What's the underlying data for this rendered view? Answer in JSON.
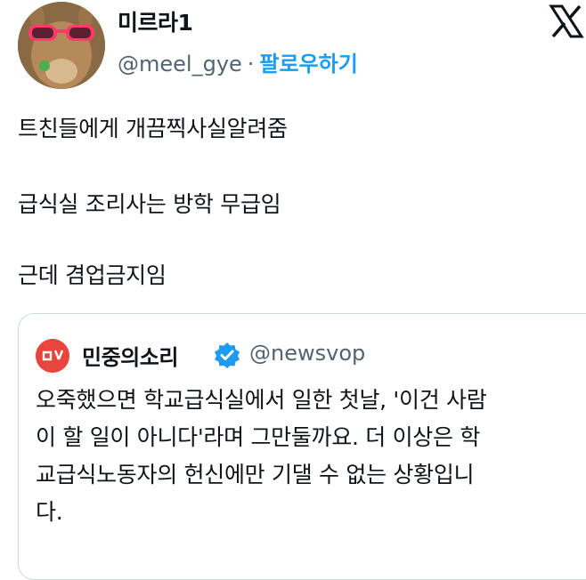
{
  "author": {
    "display_name": "미르라1",
    "handle": "@meel_gye",
    "separator": "·",
    "follow_label": "팔로우하기"
  },
  "tweet": {
    "lines": [
      "트친들에게 개끔찍사실알려줌",
      "급식실 조리사는 방학 무급임",
      "근데 겸업금지임"
    ]
  },
  "quote": {
    "display_name": "민중의소리",
    "handle": "@newsvop",
    "lines": [
      "오죽했으면 학교급식실에서 일한 첫날, '이건 사람",
      "이 할 일이 아니다'라며 그만둘까요. 더 이상은 학",
      "교급식노동자의 헌신에만 기댈 수 없는 상황입니",
      "다."
    ]
  },
  "icons": {
    "logo": "x-logo-icon",
    "verified": "verified-badge-icon"
  },
  "colors": {
    "follow": "#1d9bf0",
    "muted": "#536471",
    "text": "#0f1419",
    "card_border": "#cfd9de",
    "news_avatar": "#e8453c"
  }
}
